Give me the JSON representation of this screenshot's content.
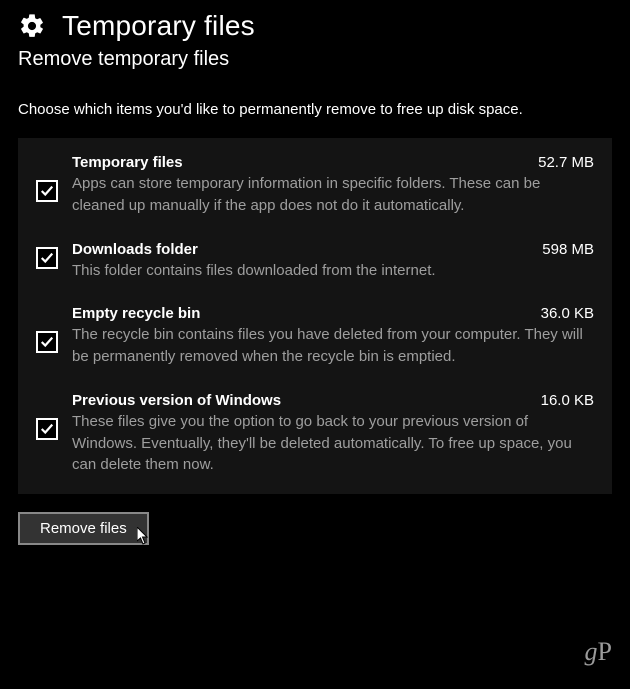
{
  "header": {
    "title": "Temporary files",
    "subtitle": "Remove temporary files",
    "instruction": "Choose which items you'd like to permanently remove to free up disk space."
  },
  "items": [
    {
      "title": "Temporary files",
      "size": "52.7 MB",
      "desc": "Apps can store temporary information in specific folders. These can be cleaned up manually if the app does not do it automatically.",
      "checked": true,
      "checkboxOffset": "mid"
    },
    {
      "title": "Downloads folder",
      "size": "598 MB",
      "desc": "This folder contains files downloaded from the internet.",
      "checked": true,
      "checkboxOffset": "top"
    },
    {
      "title": "Empty recycle bin",
      "size": "36.0 KB",
      "desc": "The recycle bin contains files you have deleted from your computer. They will be permanently removed when the recycle bin is emptied.",
      "checked": true,
      "checkboxOffset": "mid"
    },
    {
      "title": "Previous version of Windows",
      "size": "16.0 KB",
      "desc": "These files give you the option to go back to your previous version of Windows. Eventually, they'll be deleted automatically. To free up space, you can delete them now.",
      "checked": true,
      "checkboxOffset": "mid"
    }
  ],
  "buttons": {
    "remove": "Remove files"
  },
  "watermark": {
    "left": "g",
    "right": "P"
  }
}
